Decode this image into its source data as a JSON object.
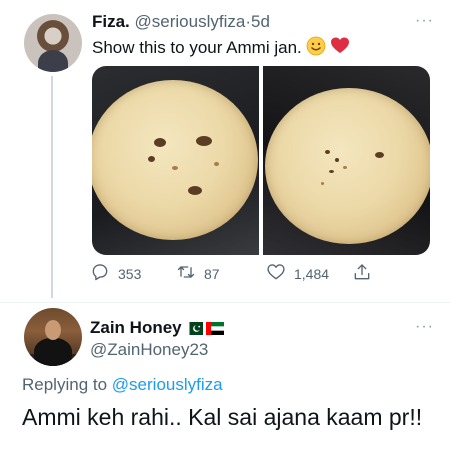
{
  "tweet1": {
    "author_name": "Fiza.",
    "author_handle": "@seriouslyfiza",
    "separator": "·",
    "age": "5d",
    "text": "Show this to your Ammi jan.",
    "emojis": [
      "smiling-face",
      "red-heart"
    ],
    "stats": {
      "replies": "353",
      "retweets": "87",
      "likes": "1,484"
    },
    "more_label": "···"
  },
  "tweet2": {
    "author_name": "Zain Honey",
    "author_handle": "@ZainHoney23",
    "flags": [
      "pakistan-flag",
      "uae-flag"
    ],
    "more_label": "···",
    "replying_prefix": "Replying to",
    "replying_handle": "@seriouslyfiza",
    "text": "Ammi keh rahi.. Kal sai ajana kaam pr!!"
  },
  "colors": {
    "text_primary": "#0f1419",
    "text_secondary": "#536471",
    "link": "#1d9bf0",
    "divider": "#eff3f4"
  }
}
